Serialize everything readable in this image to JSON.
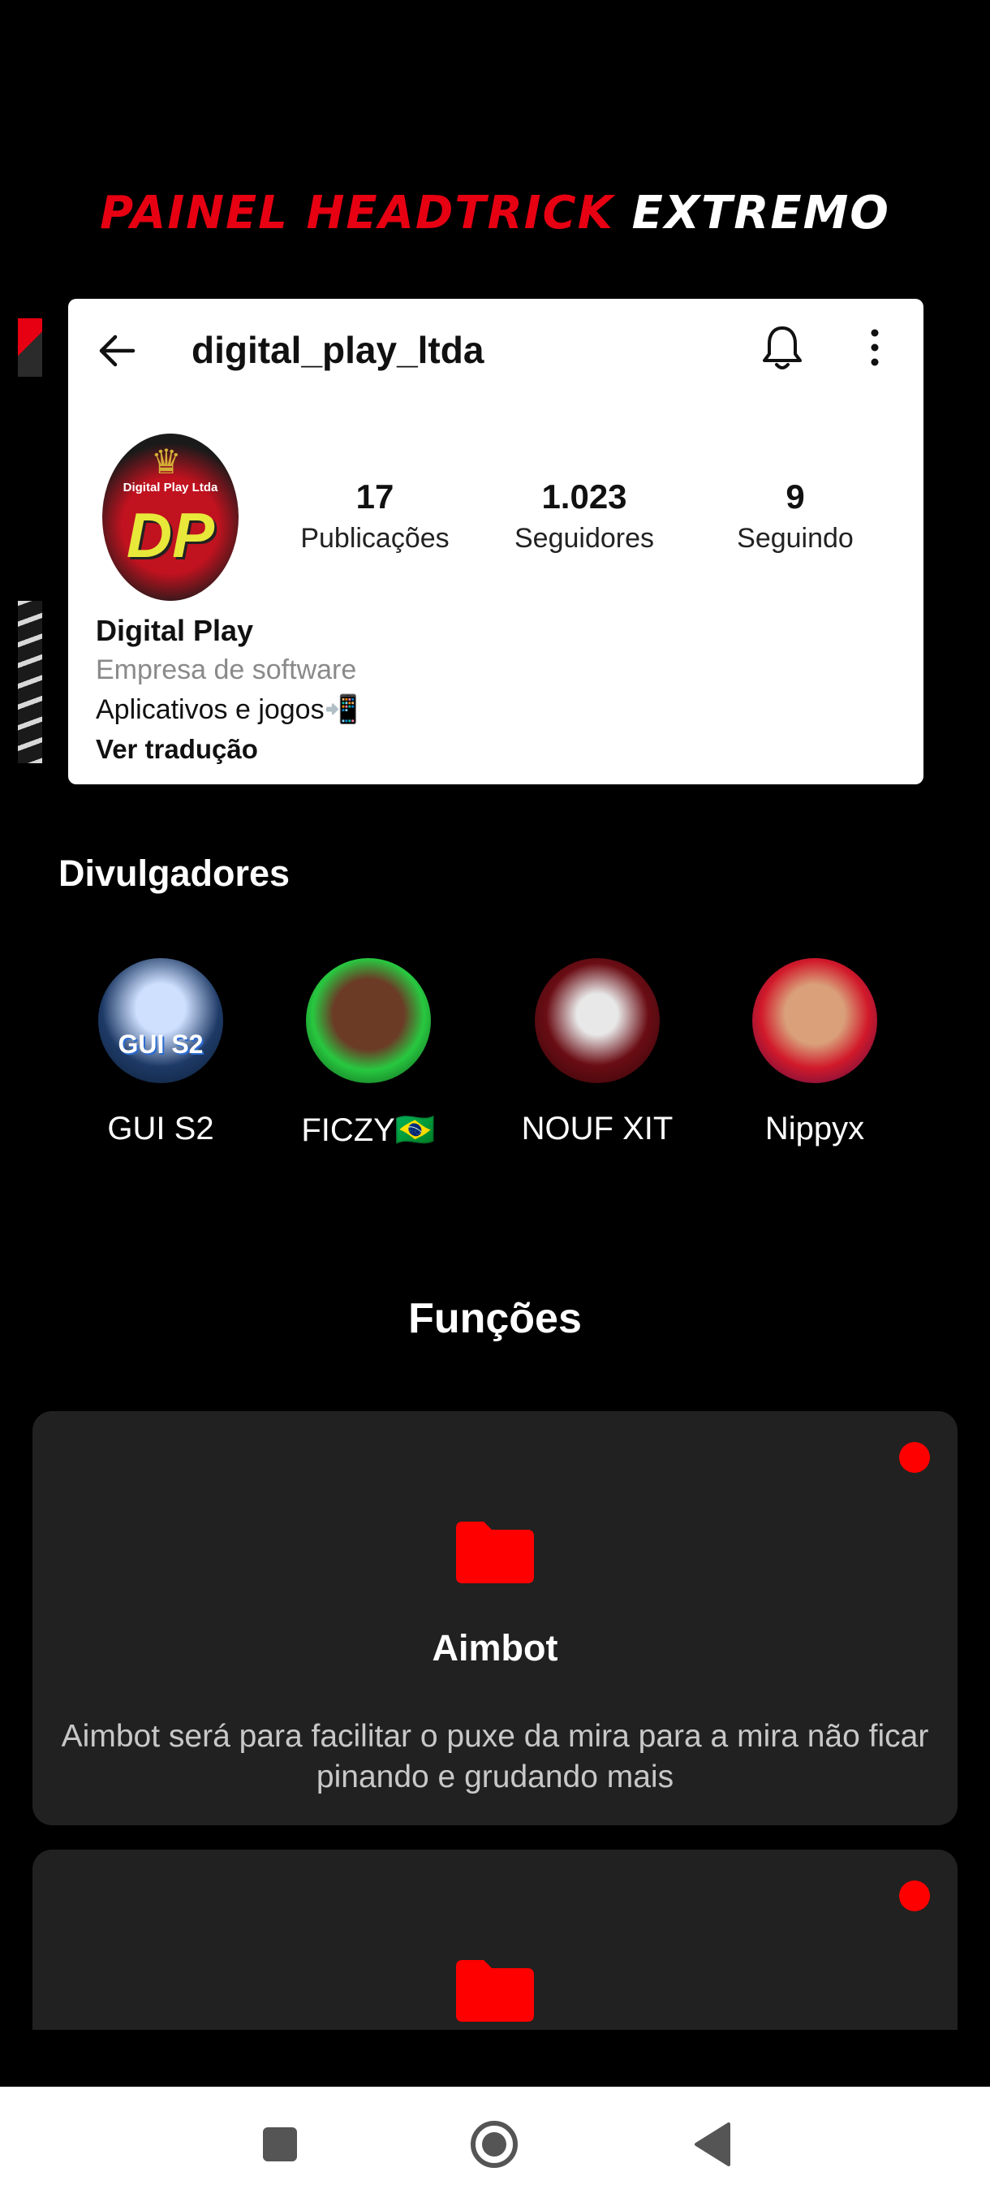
{
  "banner": {
    "title_red": "PAINEL HEADTRICK",
    "title_white": "EXTREMO",
    "accent_color": "#e60012"
  },
  "profile": {
    "username": "digital_play_ltda",
    "avatar_caption": "Digital Play Ltda",
    "avatar_initials": "DP",
    "stats": [
      {
        "value": "17",
        "label": "Publicações"
      },
      {
        "value": "1.023",
        "label": "Seguidores"
      },
      {
        "value": "9",
        "label": "Seguindo"
      }
    ],
    "display_name": "Digital Play",
    "category": "Empresa de software",
    "bio": "Aplicativos e jogos📲",
    "translate_link": "Ver tradução",
    "icons": [
      "arrow-left-icon",
      "bell-icon",
      "more-vertical-icon"
    ]
  },
  "promoters": {
    "title": "Divulgadores",
    "items": [
      {
        "name": "GUI S2",
        "avatar_text": "GUI S2"
      },
      {
        "name": "FICZY🇧🇷"
      },
      {
        "name": "NOUF XIT"
      },
      {
        "name": "Nippyx"
      }
    ]
  },
  "functions": {
    "title": "Funções",
    "cards": [
      {
        "title": "Aimbot",
        "description": "Aimbot será para facilitar o puxe da mira para a mira não ficar pinando e grudando mais",
        "icon": "folder-icon",
        "status_color": "#ff0000"
      },
      {
        "icon": "folder-icon",
        "status_color": "#ff0000"
      }
    ]
  },
  "navbar": {
    "icons": [
      "recent-apps-icon",
      "home-icon",
      "back-icon"
    ]
  }
}
